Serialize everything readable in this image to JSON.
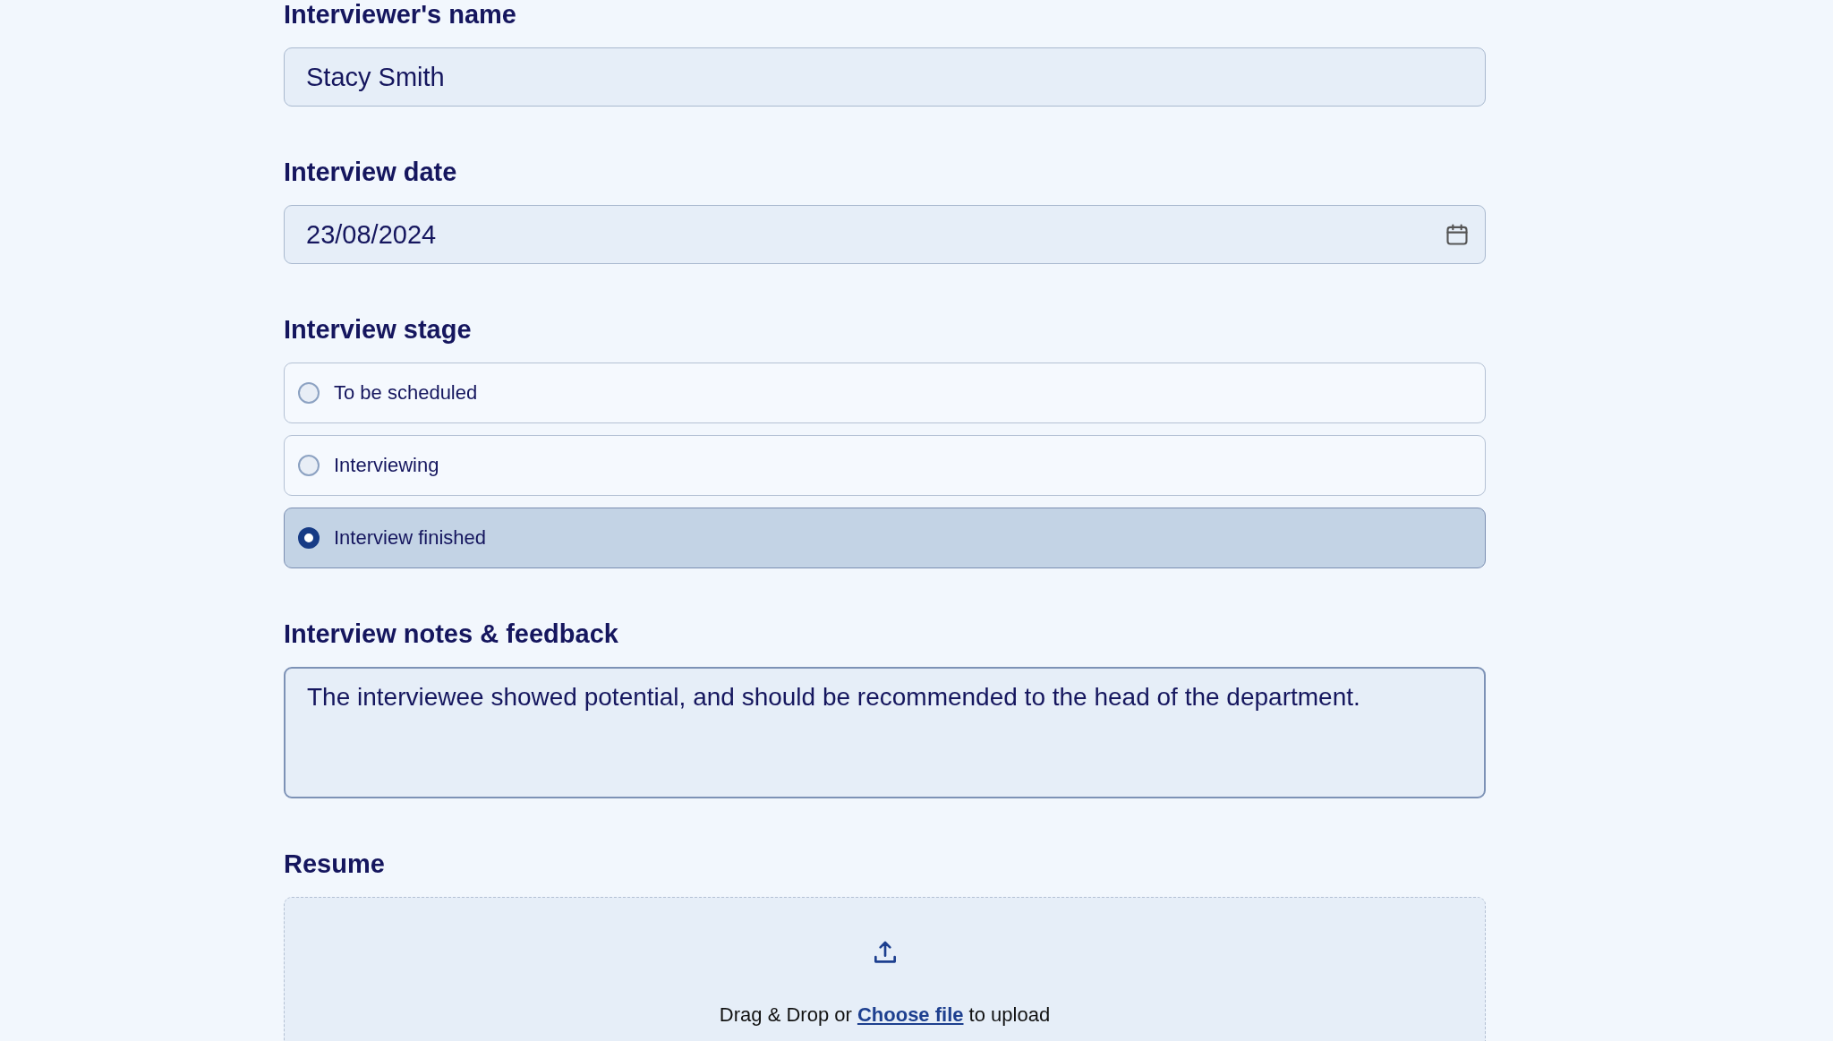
{
  "name_field": {
    "label": "Interviewer's name",
    "value": "Stacy Smith"
  },
  "date_field": {
    "label": "Interview date",
    "value": "23/08/2024"
  },
  "stage": {
    "label": "Interview stage",
    "options": [
      {
        "label": "To be scheduled",
        "selected": false
      },
      {
        "label": "Interviewing",
        "selected": false
      },
      {
        "label": "Interview finished",
        "selected": true
      }
    ]
  },
  "notes": {
    "label": "Interview notes & feedback",
    "value": "The interviewee showed potential, and should be recommended to the head of the department."
  },
  "resume": {
    "label": "Resume",
    "text_before": "Drag & Drop or",
    "link": "Choose file",
    "text_after": "to upload"
  }
}
